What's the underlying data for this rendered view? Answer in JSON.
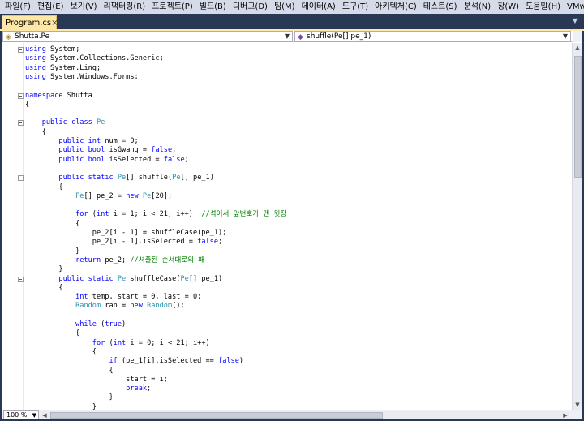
{
  "menu": [
    "파일(F)",
    "편집(E)",
    "보기(V)",
    "리팩터링(R)",
    "프로젝트(P)",
    "빌드(B)",
    "디버그(D)",
    "팀(M)",
    "데이터(A)",
    "도구(T)",
    "아키텍처(C)",
    "테스트(S)",
    "분석(N)",
    "창(W)",
    "도움말(H)",
    "VMware"
  ],
  "tab": {
    "label": "Program.cs",
    "close": "×"
  },
  "navbar": {
    "type_combo": "Shutta.Pe",
    "member_combo": "shuffle(Pe[] pe_1)"
  },
  "zoom": "100 %",
  "code_lines": [
    [
      {
        "t": "using",
        "c": "kw"
      },
      {
        "t": " System;"
      }
    ],
    [
      {
        "t": "using",
        "c": "kw"
      },
      {
        "t": " System.Collections.Generic;"
      }
    ],
    [
      {
        "t": "using",
        "c": "kw"
      },
      {
        "t": " System.Linq;"
      }
    ],
    [
      {
        "t": "using",
        "c": "kw"
      },
      {
        "t": " System.Windows.Forms;"
      }
    ],
    [],
    [
      {
        "t": "namespace",
        "c": "kw"
      },
      {
        "t": " Shutta"
      }
    ],
    [
      {
        "t": "{"
      }
    ],
    [],
    [
      {
        "t": "    public",
        "c": "kw"
      },
      {
        "t": " "
      },
      {
        "t": "class",
        "c": "kw"
      },
      {
        "t": " "
      },
      {
        "t": "Pe",
        "c": "ty"
      }
    ],
    [
      {
        "t": "    {"
      }
    ],
    [
      {
        "t": "        public",
        "c": "kw"
      },
      {
        "t": " "
      },
      {
        "t": "int",
        "c": "kw"
      },
      {
        "t": " num = 0;"
      }
    ],
    [
      {
        "t": "        public",
        "c": "kw"
      },
      {
        "t": " "
      },
      {
        "t": "bool",
        "c": "kw"
      },
      {
        "t": " isGwang = "
      },
      {
        "t": "false",
        "c": "kw"
      },
      {
        "t": ";"
      }
    ],
    [
      {
        "t": "        public",
        "c": "kw"
      },
      {
        "t": " "
      },
      {
        "t": "bool",
        "c": "kw"
      },
      {
        "t": " isSelected = "
      },
      {
        "t": "false",
        "c": "kw"
      },
      {
        "t": ";"
      }
    ],
    [],
    [
      {
        "t": "        public",
        "c": "kw"
      },
      {
        "t": " "
      },
      {
        "t": "static",
        "c": "kw"
      },
      {
        "t": " "
      },
      {
        "t": "Pe",
        "c": "ty"
      },
      {
        "t": "[] shuffle("
      },
      {
        "t": "Pe",
        "c": "ty"
      },
      {
        "t": "[] pe_1)"
      }
    ],
    [
      {
        "t": "        {"
      }
    ],
    [
      {
        "t": "            "
      },
      {
        "t": "Pe",
        "c": "ty"
      },
      {
        "t": "[] pe_2 = "
      },
      {
        "t": "new",
        "c": "kw"
      },
      {
        "t": " "
      },
      {
        "t": "Pe",
        "c": "ty"
      },
      {
        "t": "[20];"
      }
    ],
    [],
    [
      {
        "t": "            for",
        "c": "kw"
      },
      {
        "t": " ("
      },
      {
        "t": "int",
        "c": "kw"
      },
      {
        "t": " i = 1; i < 21; i++)  "
      },
      {
        "t": "//섞어서 앞번호가 맨 윗장",
        "c": "cm"
      }
    ],
    [
      {
        "t": "            {"
      }
    ],
    [
      {
        "t": "                pe_2[i - 1] = shuffleCase(pe_1);"
      }
    ],
    [
      {
        "t": "                pe_2[i - 1].isSelected = "
      },
      {
        "t": "false",
        "c": "kw"
      },
      {
        "t": ";"
      }
    ],
    [
      {
        "t": "            }"
      }
    ],
    [
      {
        "t": "            return",
        "c": "kw"
      },
      {
        "t": " pe_2; "
      },
      {
        "t": "//셔플된 순서대로의 패",
        "c": "cm"
      }
    ],
    [
      {
        "t": "        }"
      }
    ],
    [
      {
        "t": "        public",
        "c": "kw"
      },
      {
        "t": " "
      },
      {
        "t": "static",
        "c": "kw"
      },
      {
        "t": " "
      },
      {
        "t": "Pe",
        "c": "ty"
      },
      {
        "t": " shuffleCase("
      },
      {
        "t": "Pe",
        "c": "ty"
      },
      {
        "t": "[] pe_1)"
      }
    ],
    [
      {
        "t": "        {"
      }
    ],
    [
      {
        "t": "            int",
        "c": "kw"
      },
      {
        "t": " temp, start = 0, last = 0;"
      }
    ],
    [
      {
        "t": "            "
      },
      {
        "t": "Random",
        "c": "ty"
      },
      {
        "t": " ran = "
      },
      {
        "t": "new",
        "c": "kw"
      },
      {
        "t": " "
      },
      {
        "t": "Random",
        "c": "ty"
      },
      {
        "t": "();"
      }
    ],
    [],
    [
      {
        "t": "            while",
        "c": "kw"
      },
      {
        "t": " ("
      },
      {
        "t": "true",
        "c": "kw"
      },
      {
        "t": ")"
      }
    ],
    [
      {
        "t": "            {"
      }
    ],
    [
      {
        "t": "                for",
        "c": "kw"
      },
      {
        "t": " ("
      },
      {
        "t": "int",
        "c": "kw"
      },
      {
        "t": " i = 0; i < 21; i++)"
      }
    ],
    [
      {
        "t": "                {"
      }
    ],
    [
      {
        "t": "                    if",
        "c": "kw"
      },
      {
        "t": " (pe_1[i].isSelected == "
      },
      {
        "t": "false",
        "c": "kw"
      },
      {
        "t": ")"
      }
    ],
    [
      {
        "t": "                    {"
      }
    ],
    [
      {
        "t": "                        start = i;"
      }
    ],
    [
      {
        "t": "                        break",
        "c": "kw"
      },
      {
        "t": ";"
      }
    ],
    [
      {
        "t": "                    }"
      }
    ],
    [
      {
        "t": "                }"
      }
    ]
  ],
  "fold_lines": [
    0,
    5,
    8,
    14,
    25
  ]
}
